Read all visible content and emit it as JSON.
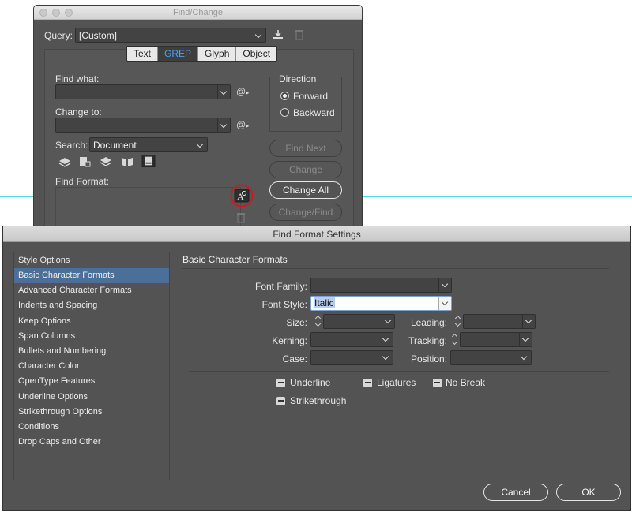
{
  "find_change": {
    "window_title": "Find/Change",
    "query_label": "Query:",
    "query_value": "[Custom]",
    "tabs": [
      {
        "label": "Text"
      },
      {
        "label": "GREP",
        "active": true
      },
      {
        "label": "Glyph"
      },
      {
        "label": "Object"
      }
    ],
    "find_what_label": "Find what:",
    "find_what_value": "",
    "change_to_label": "Change to:",
    "change_to_value": "",
    "search_label": "Search:",
    "search_value": "Document",
    "direction_label": "Direction",
    "direction_forward": "Forward",
    "direction_backward": "Backward",
    "direction_selected": "Forward",
    "find_format_label": "Find Format:",
    "buttons": {
      "find_next": "Find Next",
      "change": "Change",
      "change_all": "Change All",
      "change_find": "Change/Find"
    }
  },
  "find_format_settings": {
    "title": "Find Format Settings",
    "categories": [
      "Style Options",
      "Basic Character Formats",
      "Advanced Character Formats",
      "Indents and Spacing",
      "Keep Options",
      "Span Columns",
      "Bullets and Numbering",
      "Character Color",
      "OpenType Features",
      "Underline Options",
      "Strikethrough Options",
      "Conditions",
      "Drop Caps and Other"
    ],
    "selected_category": "Basic Character Formats",
    "section_title": "Basic Character Formats",
    "fields": {
      "font_family_label": "Font Family:",
      "font_family_value": "",
      "font_style_label": "Font Style:",
      "font_style_value": "Italic",
      "size_label": "Size:",
      "size_value": "",
      "leading_label": "Leading:",
      "leading_value": "",
      "kerning_label": "Kerning:",
      "kerning_value": "",
      "tracking_label": "Tracking:",
      "tracking_value": "",
      "case_label": "Case:",
      "case_value": "",
      "position_label": "Position:",
      "position_value": ""
    },
    "checkboxes": {
      "underline": "Underline",
      "ligatures": "Ligatures",
      "no_break": "No Break",
      "strikethrough": "Strikethrough"
    },
    "cancel_label": "Cancel",
    "ok_label": "OK"
  },
  "colors": {
    "panel_bg": "#535353",
    "selection_blue": "#4a6f99",
    "active_tab_text": "#4aa0f5",
    "highlight_circle": "#d4161c",
    "guide_line": "#4fe0e8"
  }
}
